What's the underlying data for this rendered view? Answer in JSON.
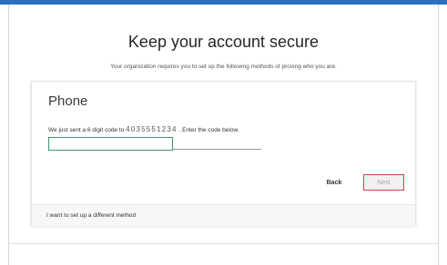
{
  "header": {
    "title": "Keep your account secure",
    "subtitle": "Your organization requires you to set up the following methods of proving who you are."
  },
  "card": {
    "heading": "Phone",
    "info_prefix": "We just sent a 6 digit code to",
    "phone_number": "4035551234",
    "info_suffix": ". Enter the code below.",
    "code_input_value": "",
    "back_label": "Back",
    "next_label": "Next",
    "alt_method_label": "I want to set up a different method"
  },
  "colors": {
    "accent_bar": "#2b6fc4",
    "input_focus": "#3a9a6a",
    "next_highlight": "#c9444f"
  }
}
